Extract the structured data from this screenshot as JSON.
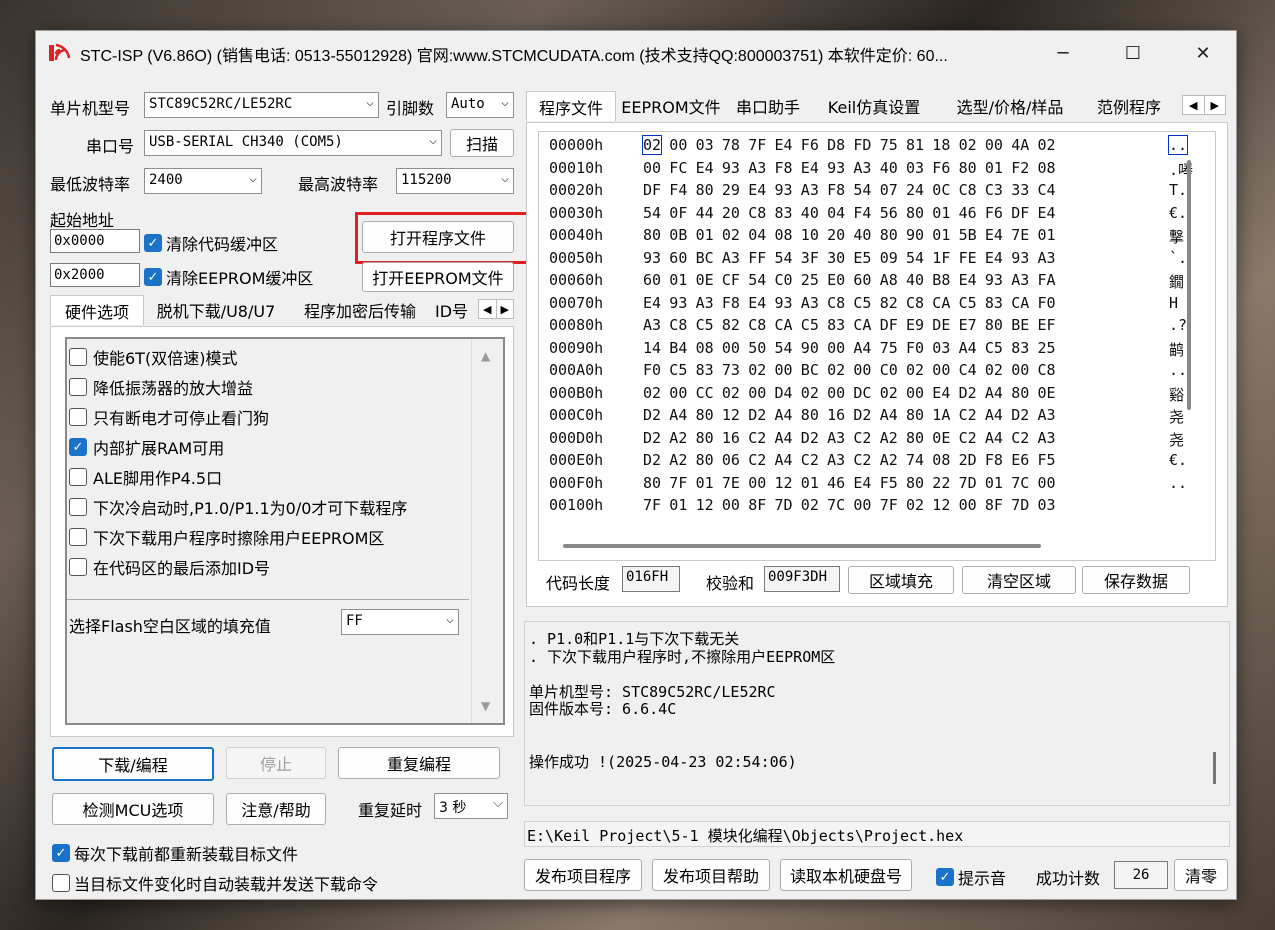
{
  "window": {
    "title": "STC-ISP (V6.86O) (销售电话: 0513-55012928) 官网:www.STCMCUDATA.com  (技术支持QQ:800003751) 本软件定价: 60...",
    "min": "─",
    "max": "☐",
    "close": "✕"
  },
  "left": {
    "mcu_label": "单片机型号",
    "mcu_value": "STC89C52RC/LE52RC",
    "pins_label": "引脚数",
    "pins_value": "Auto",
    "port_label": "串口号",
    "port_value": "USB-SERIAL CH340 (COM5)",
    "scan_button": "扫描",
    "min_baud_label": "最低波特率",
    "min_baud_value": "2400",
    "max_baud_label": "最高波特率",
    "max_baud_value": "115200",
    "start_addr_label": "起始地址",
    "addr1": "0x0000",
    "clear_code": "清除代码缓冲区",
    "addr2": "0x2000",
    "clear_eeprom": "清除EEPROM缓冲区",
    "open_prog": "打开程序文件",
    "open_eeprom": "打开EEPROM文件",
    "tabs": [
      "硬件选项",
      "脱机下载/U8/U7",
      "程序加密后传输",
      "ID号"
    ],
    "options": [
      {
        "label": "使能6T(双倍速)模式",
        "checked": false
      },
      {
        "label": "降低振荡器的放大增益",
        "checked": false
      },
      {
        "label": "只有断电才可停止看门狗",
        "checked": false
      },
      {
        "label": "内部扩展RAM可用",
        "checked": true
      },
      {
        "label": "ALE脚用作P4.5口",
        "checked": false
      },
      {
        "label": "下次冷启动时,P1.0/P1.1为0/0才可下载程序",
        "checked": false
      },
      {
        "label": "下次下载用户程序时擦除用户EEPROM区",
        "checked": false
      },
      {
        "label": "在代码区的最后添加ID号",
        "checked": false
      }
    ],
    "fill_label": "选择Flash空白区域的填充值",
    "fill_value": "FF",
    "download": "下载/编程",
    "stop": "停止",
    "reprogram": "重复编程",
    "detect": "检测MCU选项",
    "help": "注意/帮助",
    "delay_label": "重复延时",
    "delay_value": "3 秒",
    "reload_label": "每次下载前都重新装载目标文件",
    "reload_checked": true,
    "auto_label": "当目标文件变化时自动装载并发送下载命令",
    "auto_checked": false
  },
  "right": {
    "tabs": [
      "程序文件",
      "EEPROM文件",
      "串口助手",
      "Keil仿真设置",
      "选型/价格/样品",
      "范例程序"
    ],
    "hex_rows": [
      {
        "addr": "00000h",
        "bytes": [
          "02",
          "00",
          "03",
          "78",
          "7F",
          "E4",
          "F6",
          "D8",
          "FD",
          "75",
          "81",
          "18",
          "02",
          "00",
          "4A",
          "02"
        ],
        "ascii": ".."
      },
      {
        "addr": "00010h",
        "bytes": [
          "00",
          "FC",
          "E4",
          "93",
          "A3",
          "F8",
          "E4",
          "93",
          "A3",
          "40",
          "03",
          "F6",
          "80",
          "01",
          "F2",
          "08"
        ],
        "ascii": ".唪"
      },
      {
        "addr": "00020h",
        "bytes": [
          "DF",
          "F4",
          "80",
          "29",
          "E4",
          "93",
          "A3",
          "F8",
          "54",
          "07",
          "24",
          "0C",
          "C8",
          "C3",
          "33",
          "C4"
        ],
        "ascii": "T."
      },
      {
        "addr": "00030h",
        "bytes": [
          "54",
          "0F",
          "44",
          "20",
          "C8",
          "83",
          "40",
          "04",
          "F4",
          "56",
          "80",
          "01",
          "46",
          "F6",
          "DF",
          "E4"
        ],
        "ascii": "€."
      },
      {
        "addr": "00040h",
        "bytes": [
          "80",
          "0B",
          "01",
          "02",
          "04",
          "08",
          "10",
          "20",
          "40",
          "80",
          "90",
          "01",
          "5B",
          "E4",
          "7E",
          "01"
        ],
        "ascii": "撃"
      },
      {
        "addr": "00050h",
        "bytes": [
          "93",
          "60",
          "BC",
          "A3",
          "FF",
          "54",
          "3F",
          "30",
          "E5",
          "09",
          "54",
          "1F",
          "FE",
          "E4",
          "93",
          "A3"
        ],
        "ascii": "`."
      },
      {
        "addr": "00060h",
        "bytes": [
          "60",
          "01",
          "0E",
          "CF",
          "54",
          "C0",
          "25",
          "E0",
          "60",
          "A8",
          "40",
          "B8",
          "E4",
          "93",
          "A3",
          "FA"
        ],
        "ascii": "鐗"
      },
      {
        "addr": "00070h",
        "bytes": [
          "E4",
          "93",
          "A3",
          "F8",
          "E4",
          "93",
          "A3",
          "C8",
          "C5",
          "82",
          "C8",
          "CA",
          "C5",
          "83",
          "CA",
          "F0"
        ],
        "ascii": "H"
      },
      {
        "addr": "00080h",
        "bytes": [
          "A3",
          "C8",
          "C5",
          "82",
          "C8",
          "CA",
          "C5",
          "83",
          "CA",
          "DF",
          "E9",
          "DE",
          "E7",
          "80",
          "BE",
          "EF"
        ],
        "ascii": ".?"
      },
      {
        "addr": "00090h",
        "bytes": [
          "14",
          "B4",
          "08",
          "00",
          "50",
          "54",
          "90",
          "00",
          "A4",
          "75",
          "F0",
          "03",
          "A4",
          "C5",
          "83",
          "25"
        ],
        "ascii": "鹋"
      },
      {
        "addr": "000A0h",
        "bytes": [
          "F0",
          "C5",
          "83",
          "73",
          "02",
          "00",
          "BC",
          "02",
          "00",
          "C0",
          "02",
          "00",
          "C4",
          "02",
          "00",
          "C8"
        ],
        "ascii": ".."
      },
      {
        "addr": "000B0h",
        "bytes": [
          "02",
          "00",
          "CC",
          "02",
          "00",
          "D4",
          "02",
          "00",
          "DC",
          "02",
          "00",
          "E4",
          "D2",
          "A4",
          "80",
          "0E"
        ],
        "ascii": "谿"
      },
      {
        "addr": "000C0h",
        "bytes": [
          "D2",
          "A4",
          "80",
          "12",
          "D2",
          "A4",
          "80",
          "16",
          "D2",
          "A4",
          "80",
          "1A",
          "C2",
          "A4",
          "D2",
          "A3"
        ],
        "ascii": "尧"
      },
      {
        "addr": "000D0h",
        "bytes": [
          "D2",
          "A2",
          "80",
          "16",
          "C2",
          "A4",
          "D2",
          "A3",
          "C2",
          "A2",
          "80",
          "0E",
          "C2",
          "A4",
          "C2",
          "A3"
        ],
        "ascii": "尧"
      },
      {
        "addr": "000E0h",
        "bytes": [
          "D2",
          "A2",
          "80",
          "06",
          "C2",
          "A4",
          "C2",
          "A3",
          "C2",
          "A2",
          "74",
          "08",
          "2D",
          "F8",
          "E6",
          "F5"
        ],
        "ascii": "€."
      },
      {
        "addr": "000F0h",
        "bytes": [
          "80",
          "7F",
          "01",
          "7E",
          "00",
          "12",
          "01",
          "46",
          "E4",
          "F5",
          "80",
          "22",
          "7D",
          "01",
          "7C",
          "00"
        ],
        "ascii": ".."
      },
      {
        "addr": "00100h",
        "bytes": [
          "7F",
          "01",
          "12",
          "00",
          "8F",
          "7D",
          "02",
          "7C",
          "00",
          "7F",
          "02",
          "12",
          "00",
          "8F",
          "7D",
          "03"
        ],
        "ascii": ""
      }
    ],
    "code_len_label": "代码长度",
    "code_len_value": "016FH",
    "checksum_label": "校验和",
    "checksum_value": "009F3DH",
    "fill_area": "区域填充",
    "clear_area": "清空区域",
    "save_data": "保存数据",
    "log_lines": [
      ". P1.0和P1.1与下次下载无关",
      ". 下次下载用户程序时,不擦除用户EEPROM区",
      "",
      "单片机型号: STC89C52RC/LE52RC",
      "固件版本号: 6.6.4C",
      "",
      "",
      "操作成功 !(2025-04-23 02:54:06)"
    ],
    "file_path": "E:\\Keil Project\\5-1 模块化编程\\Objects\\Project.hex",
    "publish_prog": "发布项目程序",
    "publish_help": "发布项目帮助",
    "read_disk": "读取本机硬盘号",
    "beep_label": "提示音",
    "beep_checked": true,
    "success_label": "成功计数",
    "success_value": "26",
    "clear_count": "清零"
  },
  "colors": {
    "accent": "#1a73c9",
    "highlight_box": "#e02020"
  }
}
